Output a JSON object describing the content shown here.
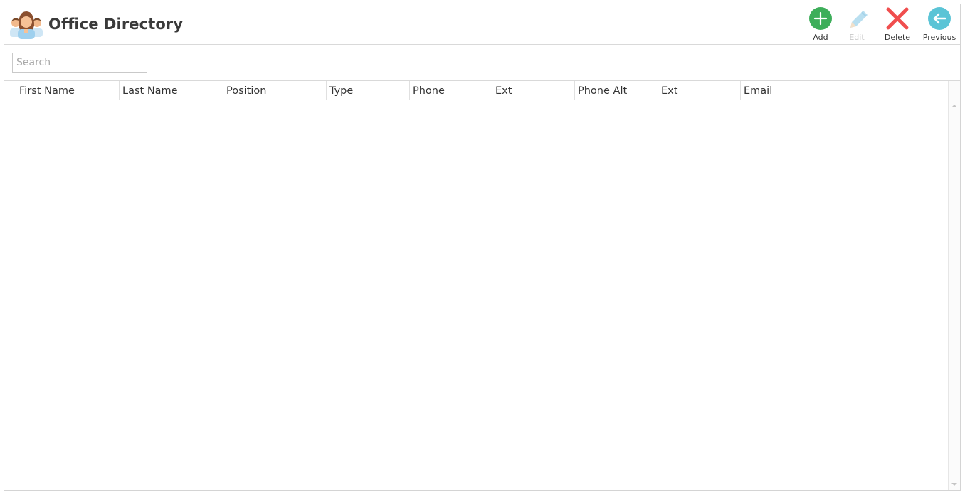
{
  "app": {
    "title": "Office Directory",
    "icon": "people-group-icon"
  },
  "toolbar": {
    "add_label": "Add",
    "edit_label": "Edit",
    "delete_label": "Delete",
    "previous_label": "Previous"
  },
  "search": {
    "placeholder": "Search",
    "value": ""
  },
  "table": {
    "columns": [
      "First Name",
      "Last Name",
      "Position",
      "Type",
      "Phone",
      "Ext",
      "Phone Alt",
      "Ext",
      "Email"
    ],
    "rows": []
  },
  "colors": {
    "add": "#3dae5a",
    "edit_disabled": "#b9dff0",
    "delete": "#f04e4e",
    "previous": "#5bc4d6",
    "border": "#d9d9d9"
  }
}
